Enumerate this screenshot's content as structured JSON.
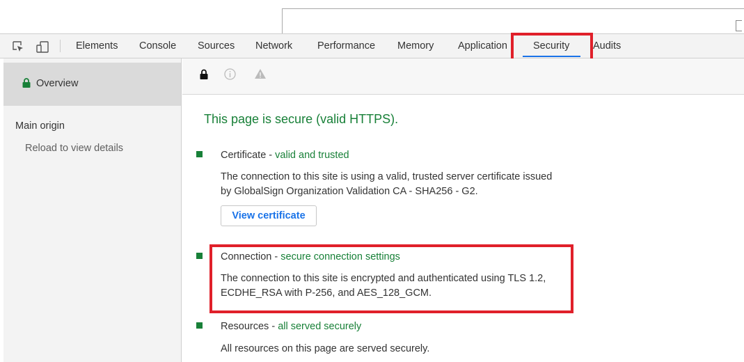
{
  "toolbar": {
    "tabs": [
      {
        "label": "Elements"
      },
      {
        "label": "Console"
      },
      {
        "label": "Sources"
      },
      {
        "label": "Network"
      },
      {
        "label": "Performance"
      },
      {
        "label": "Memory"
      },
      {
        "label": "Application"
      },
      {
        "label": "Security",
        "active": true
      },
      {
        "label": "Audits"
      }
    ],
    "icons": [
      "inspect-element-icon",
      "device-toggle-icon"
    ]
  },
  "sidebar": {
    "overview_label": "Overview",
    "main_origin_label": "Main origin",
    "reload_hint": "Reload to view details"
  },
  "status_icons": [
    "lock-icon",
    "info-icon",
    "warning-icon"
  ],
  "main": {
    "summary": "This page is secure (valid HTTPS).",
    "sections": [
      {
        "title": "Certificate",
        "separator": " - ",
        "status": "valid and trusted",
        "lines": [
          "The connection to this site is using a valid, trusted server certificate issued",
          "by GlobalSign Organization Validation CA - SHA256 - G2."
        ],
        "button_label": "View certificate"
      },
      {
        "title": "Connection",
        "separator": " - ",
        "status": "secure connection settings",
        "lines": [
          "The connection to this site is encrypted and authenticated using TLS 1.2,",
          "ECDHE_RSA with P-256, and AES_128_GCM."
        ]
      },
      {
        "title": "Resources",
        "separator": " - ",
        "status": "all served securely",
        "lines": [
          "All resources on this page are served securely."
        ]
      }
    ]
  },
  "colors": {
    "secure_green": "#188038",
    "highlight_red": "#e0202a",
    "link_blue": "#1a73e8"
  }
}
